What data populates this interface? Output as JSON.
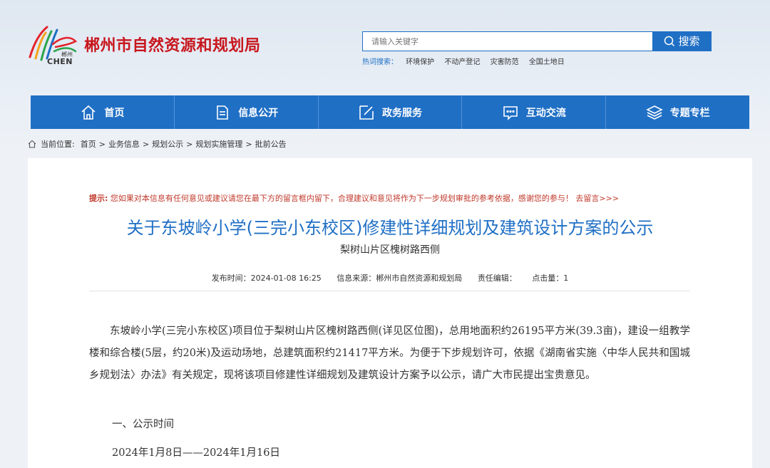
{
  "header": {
    "logo_sub": "郴州",
    "logo_en": "CHEN",
    "site_title": "郴州市自然资源和规划局"
  },
  "search": {
    "placeholder": "请输入关键字",
    "button_label": "搜索",
    "hot_label": "热词搜索：",
    "hot_items": [
      "环境保护",
      "不动产登记",
      "灾害防范",
      "全国土地日"
    ]
  },
  "nav": {
    "items": [
      {
        "label": "首页",
        "icon": "home-icon"
      },
      {
        "label": "信息公开",
        "icon": "document-icon"
      },
      {
        "label": "政务服务",
        "icon": "edit-icon"
      },
      {
        "label": "互动交流",
        "icon": "chat-icon"
      },
      {
        "label": "专题专栏",
        "icon": "layers-icon"
      }
    ]
  },
  "breadcrumb": {
    "label": "当前位置:",
    "items": [
      "首页",
      "业务信息",
      "规划公示",
      "规划实施管理",
      "批前公告"
    ],
    "separator": ">"
  },
  "tip": {
    "label": "提示:",
    "text": "您如果对本信息有任何意见或建议请您在最下方的留言框内留下，合理建议和意见将作为下一步规划审批的参考依据，感谢您的参与！",
    "link": "去留言>>>"
  },
  "article": {
    "title": "关于东坡岭小学(三完小东校区)修建性详细规划及建筑设计方案的公示",
    "subtitle": "梨树山片区槐树路西侧",
    "meta": {
      "publish_time": "发布时间：2024-01-08 16:25",
      "source": "信息来源：郴州市自然资源和规划局",
      "editor": "责任编辑：",
      "views": "点击量：1"
    },
    "paragraph": "东坡岭小学(三完小东校区)项目位于梨树山片区槐树路西侧(详见区位图)，总用地面积约26195平方米(39.3亩)，建设一组教学楼和综合楼(5层，约20米)及运动场地，总建筑面积约21417平方米。为便于下步规划许可，依据《湖南省实施〈中华人民共和国城乡规划法〉办法》有关规定，现将该项目修建性详细规划及建筑设计方案予以公示，请广大市民提出宝贵意见。",
    "section_heading": "一、公示时间",
    "date_range": "2024年1月8日——2024年1月16日"
  },
  "colors": {
    "primary": "#1f6fc5",
    "brand_red": "#c8171e",
    "tip_red": "#c0392b"
  }
}
